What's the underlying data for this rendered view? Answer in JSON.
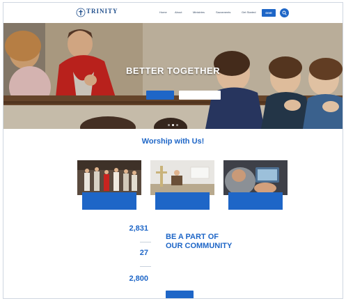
{
  "header": {
    "logo_name": "TRINITY",
    "logo_tagline": "",
    "nav": [
      "Home",
      "About",
      "Ministries",
      "Sacraments",
      "Get Started"
    ],
    "give_label": "GIVE"
  },
  "hero": {
    "title": "BETTER TOGETHER",
    "subtitle": "",
    "primary_button": "",
    "secondary_button": "",
    "slides": 3,
    "active_slide": 1
  },
  "worship": {
    "title": "Worship with Us!",
    "subtitle": "",
    "cards": [
      {
        "title": "",
        "line": ""
      },
      {
        "title": "",
        "line": ""
      },
      {
        "title": "",
        "line": ""
      }
    ]
  },
  "stats": [
    {
      "value": "2,831",
      "label": ""
    },
    {
      "value": "27",
      "label": ""
    },
    {
      "value": "2,800",
      "label": ""
    }
  ],
  "community": {
    "eyebrow": "",
    "title_line1": "BE A PART OF",
    "title_line2": "OUR COMMUNITY",
    "body": "",
    "button": ""
  },
  "colors": {
    "accent": "#1e66c7",
    "hero_red": "#c8241f"
  }
}
